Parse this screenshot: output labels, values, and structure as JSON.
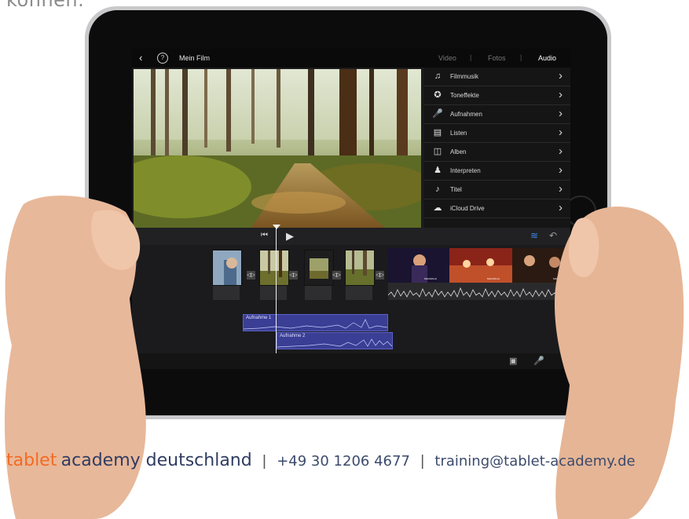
{
  "top_text": "können.",
  "app": {
    "back_icon": "chevron-left-icon",
    "help_icon": "help-icon",
    "title": "Mein Film",
    "tabs": [
      {
        "label": "Video",
        "active": false
      },
      {
        "label": "Fotos",
        "active": false
      },
      {
        "label": "Audio",
        "active": true
      }
    ],
    "tab_separator": "|"
  },
  "audio_list": [
    {
      "icon": "music-note-icon",
      "label": "Filmmusik"
    },
    {
      "icon": "sparkle-icon",
      "label": "Toneffekte"
    },
    {
      "icon": "microphone-icon",
      "label": "Aufnahmen"
    },
    {
      "icon": "playlist-icon",
      "label": "Listen"
    },
    {
      "icon": "album-icon",
      "label": "Alben"
    },
    {
      "icon": "artist-icon",
      "label": "Interpreten"
    },
    {
      "icon": "music-note-icon",
      "label": "Titel"
    },
    {
      "icon": "cloud-icon",
      "label": "iCloud Drive"
    }
  ],
  "timeline": {
    "audio_tracks": [
      {
        "label": "Aufnahme 1"
      },
      {
        "label": "Aufnahme 2"
      }
    ],
    "clip_badges": [
      "MAGNOLIA",
      "MAGNOLIA",
      "MAGNOLIA"
    ]
  },
  "colors": {
    "accent_blue": "#3b86e8",
    "audio_track": "#3a3e94",
    "brand_orange": "#f26b22",
    "brand_navy": "#2f3c61"
  },
  "footer": {
    "brand_part1": "tablet",
    "brand_part2": "academy deutschland",
    "separator": "|",
    "phone": "+49 30 1206 4677",
    "email": "training@tablet-academy.de"
  }
}
